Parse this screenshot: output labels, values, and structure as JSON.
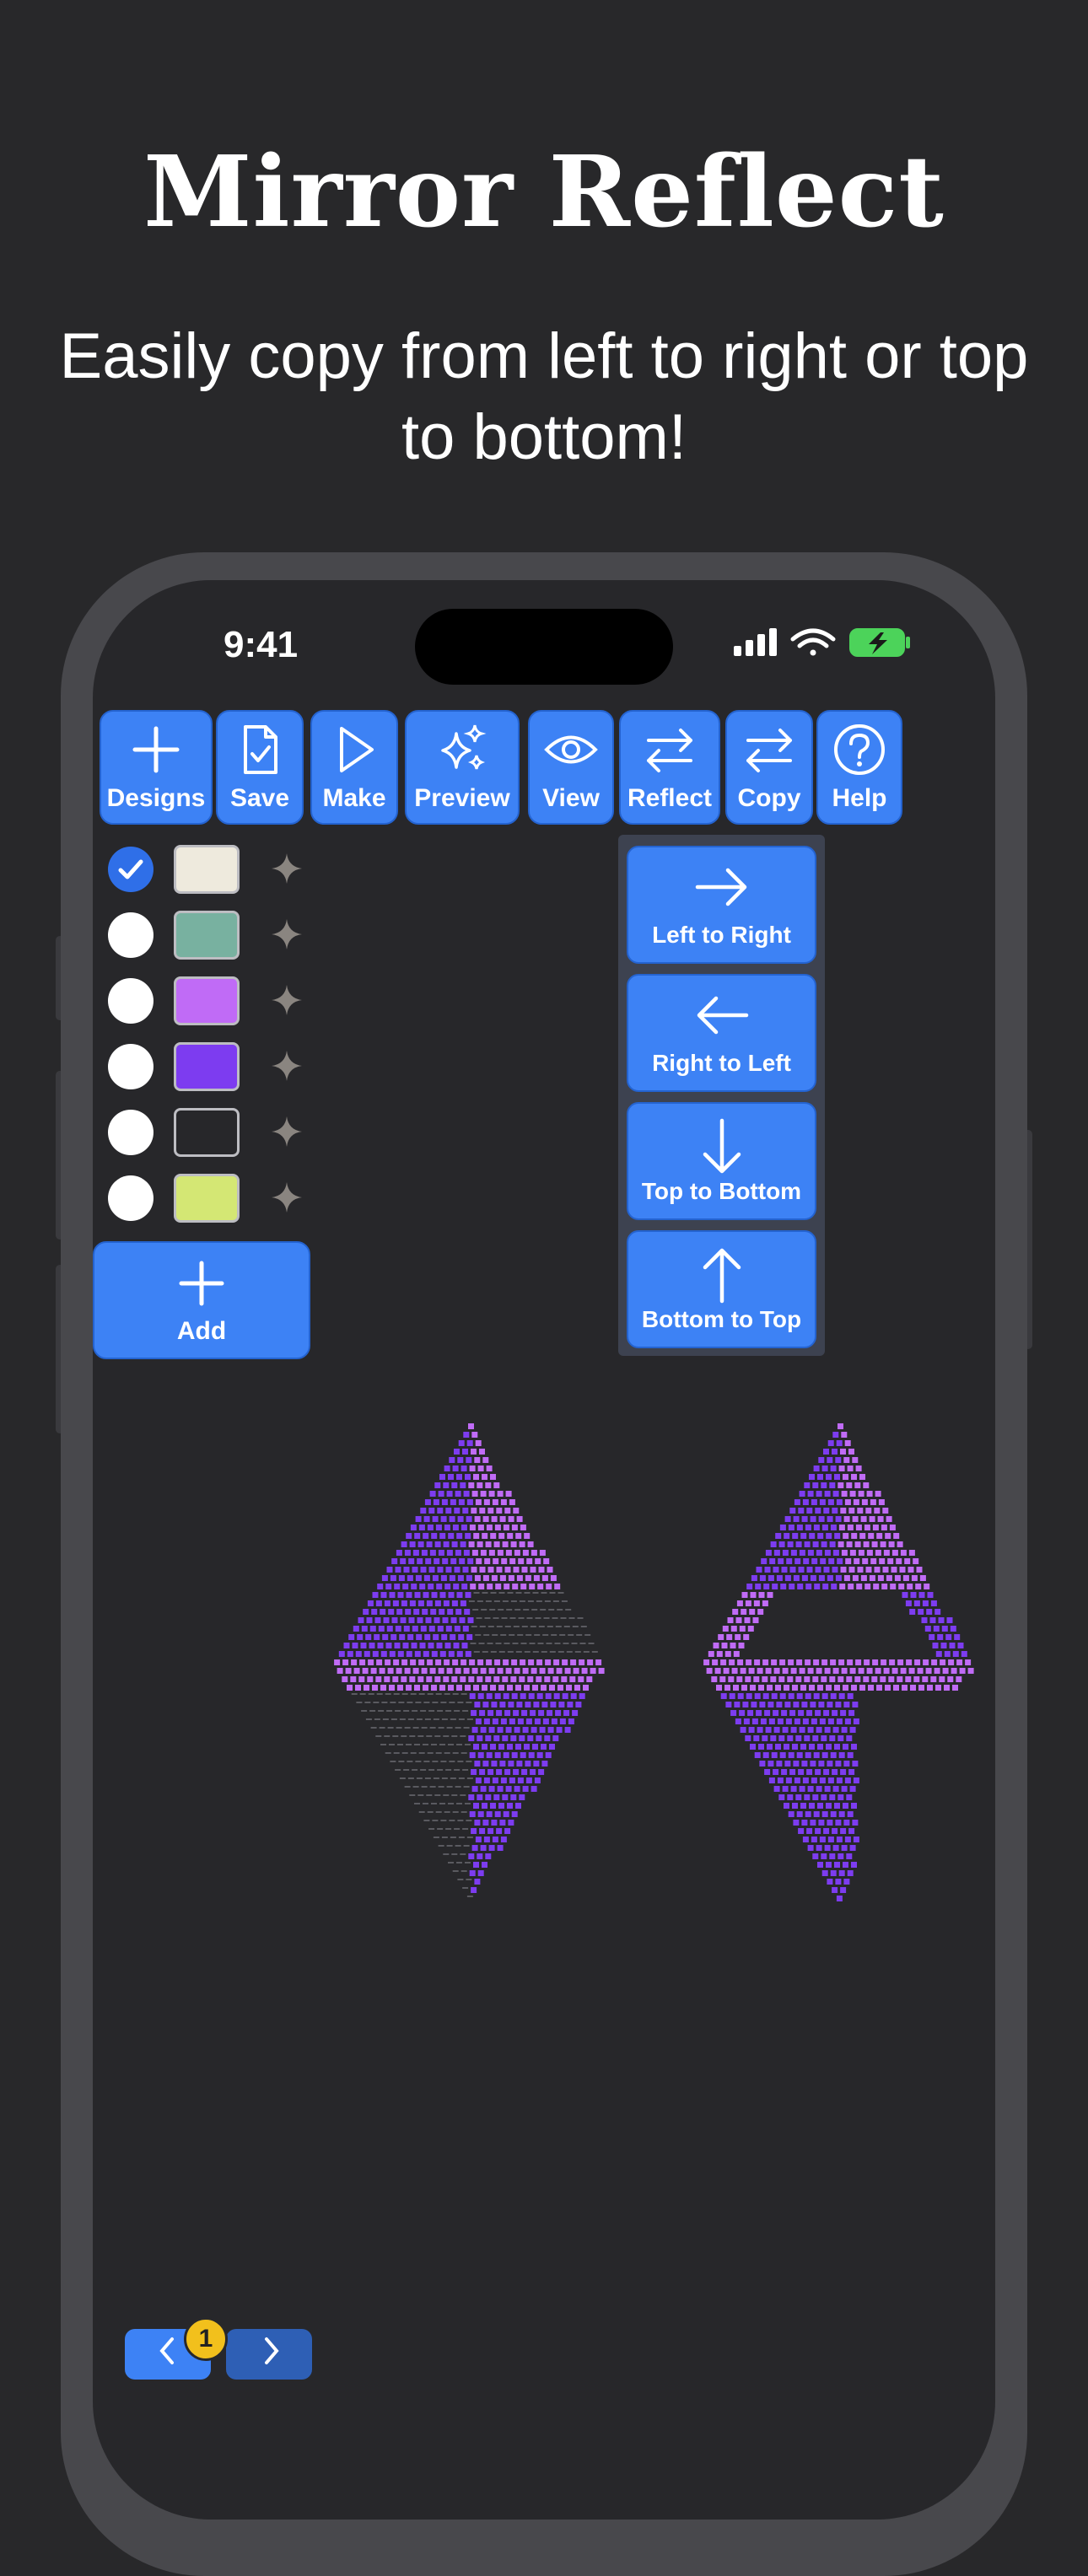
{
  "marketing": {
    "headline": "Mirror Reflect",
    "subline": "Easily copy from left to right or top to bottom!"
  },
  "status_bar": {
    "time": "9:41"
  },
  "toolbar": {
    "items": [
      {
        "label": "Designs",
        "icon": "plus-icon"
      },
      {
        "label": "Save",
        "icon": "document-check-icon"
      },
      {
        "label": "Make",
        "icon": "play-icon"
      },
      {
        "label": "Preview",
        "icon": "sparkles-icon"
      },
      {
        "label": "View",
        "icon": "eye-icon"
      },
      {
        "label": "Reflect",
        "icon": "arrows-swap-icon"
      },
      {
        "label": "Copy",
        "icon": "arrows-swap-icon"
      },
      {
        "label": "Help",
        "icon": "question-circle-icon"
      }
    ]
  },
  "palette": {
    "colors": [
      {
        "hex": "#eeeadd",
        "selected": true
      },
      {
        "hex": "#78b1a0",
        "selected": false
      },
      {
        "hex": "#c06bf6",
        "selected": false
      },
      {
        "hex": "#7d3cf0",
        "selected": false
      },
      {
        "hex": "#27272a",
        "selected": false
      },
      {
        "hex": "#d4e774",
        "selected": false
      }
    ],
    "add_label": "Add"
  },
  "reflect_menu": {
    "options": [
      {
        "label": "Left to Right",
        "icon": "arrow-right-icon"
      },
      {
        "label": "Right to Left",
        "icon": "arrow-left-icon"
      },
      {
        "label": "Top to Bottom",
        "icon": "arrow-down-icon"
      },
      {
        "label": "Bottom to Top",
        "icon": "arrow-up-icon"
      }
    ]
  },
  "bottom_nav": {
    "badge_count": "1"
  },
  "colors": {
    "accent": "#3d82f5",
    "background": "#28282a",
    "art_dark": "#7d3cf0",
    "art_light": "#c06bf6"
  }
}
